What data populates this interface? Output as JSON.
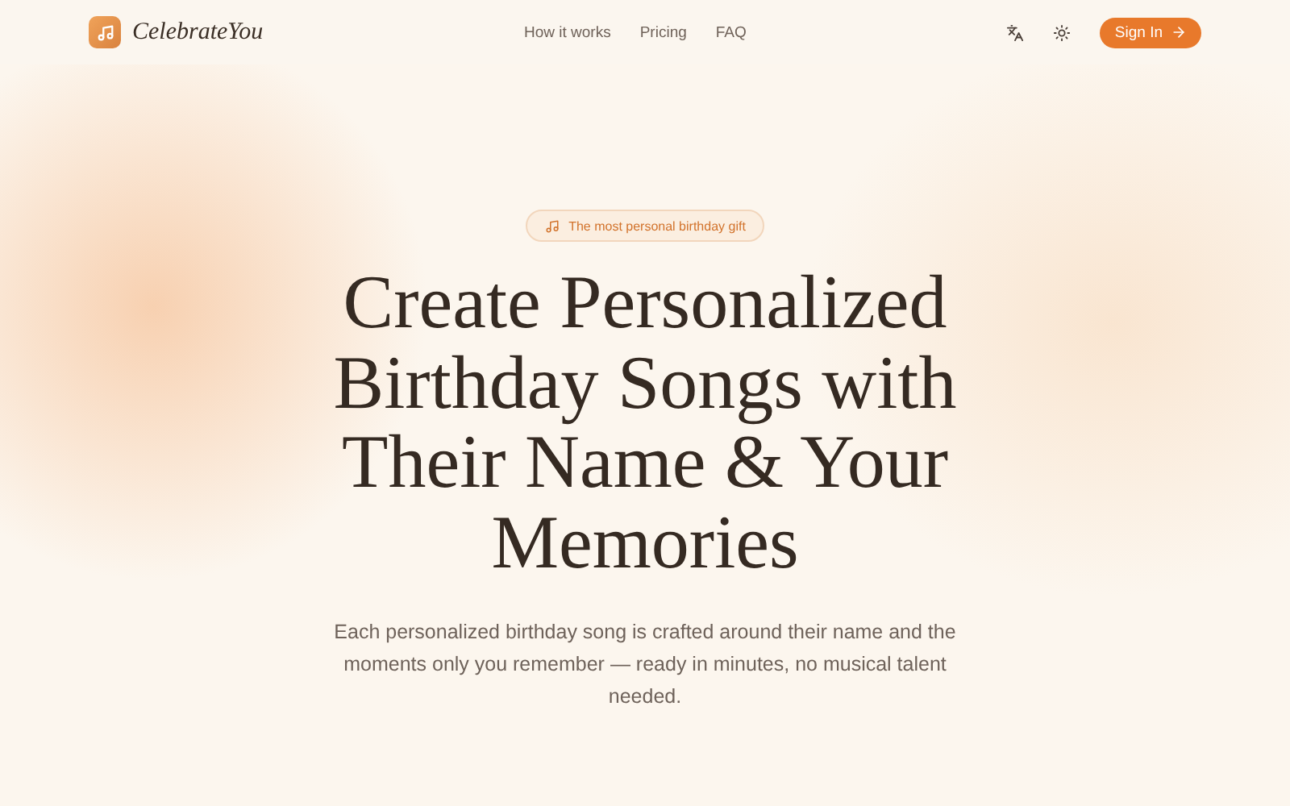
{
  "header": {
    "brand": "CelebrateYou",
    "nav": [
      {
        "label": "How it works"
      },
      {
        "label": "Pricing"
      },
      {
        "label": "FAQ"
      }
    ],
    "sign_in": "Sign In"
  },
  "hero": {
    "badge": "The most personal birthday gift",
    "title": "Create Personalized Birthday Songs with Their Name & Your Memories",
    "subtitle": "Each personalized birthday song is crafted around their name and the moments only you remember — ready in minutes, no musical talent needed."
  }
}
